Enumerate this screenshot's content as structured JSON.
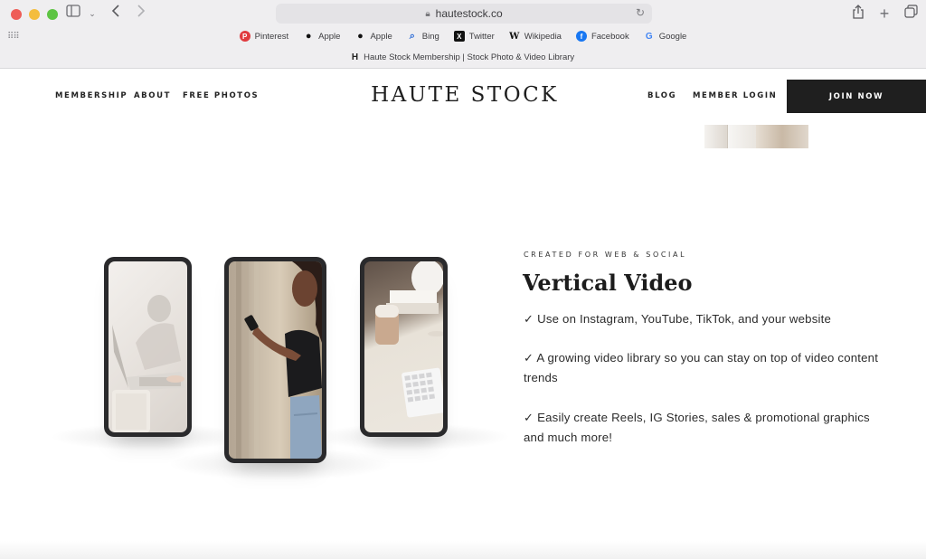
{
  "browser": {
    "url": "hautestock.co",
    "tab_title": "Haute Stock Membership | Stock Photo & Video Library",
    "tab_favicon": "H",
    "favorites": [
      {
        "label": "Pinterest",
        "icon": "pinterest-icon",
        "color": "#e03a3e",
        "glyph": "P"
      },
      {
        "label": "Apple",
        "icon": "apple-icon",
        "color": "#ffffff",
        "glyph": ""
      },
      {
        "label": "Apple",
        "icon": "apple-icon",
        "color": "#ffffff",
        "glyph": ""
      },
      {
        "label": "Bing",
        "icon": "search-icon",
        "color": "#ffffff",
        "glyph": "⌕"
      },
      {
        "label": "Twitter",
        "icon": "x-icon",
        "color": "#111111",
        "glyph": "X"
      },
      {
        "label": "Wikipedia",
        "icon": "wikipedia-icon",
        "color": "#ffffff",
        "glyph": "W"
      },
      {
        "label": "Facebook",
        "icon": "facebook-icon",
        "color": "#1877f2",
        "glyph": "f"
      },
      {
        "label": "Google",
        "icon": "google-icon",
        "color": "#ffffff",
        "glyph": "G"
      }
    ]
  },
  "nav": {
    "left": [
      "MEMBERSHIP",
      "ABOUT",
      "FREE PHOTOS"
    ],
    "logo": "HAUTE STOCK",
    "right": [
      "BLOG",
      "MEMBER LOGIN"
    ],
    "cta": "JOIN NOW"
  },
  "section": {
    "eyebrow": "CREATED FOR WEB & SOCIAL",
    "headline": "Vertical Video",
    "bullets": [
      "✓ Use on Instagram, YouTube, TikTok, and your website",
      "✓ A growing video library so you can stay on top of video content trends",
      "✓ Easily create Reels, IG Stories, sales & promotional graphics and much more!"
    ]
  },
  "colors": {
    "cta_bg": "#1f1f1f",
    "text": "#2b2b2b",
    "chrome_bg": "#efeef0"
  }
}
